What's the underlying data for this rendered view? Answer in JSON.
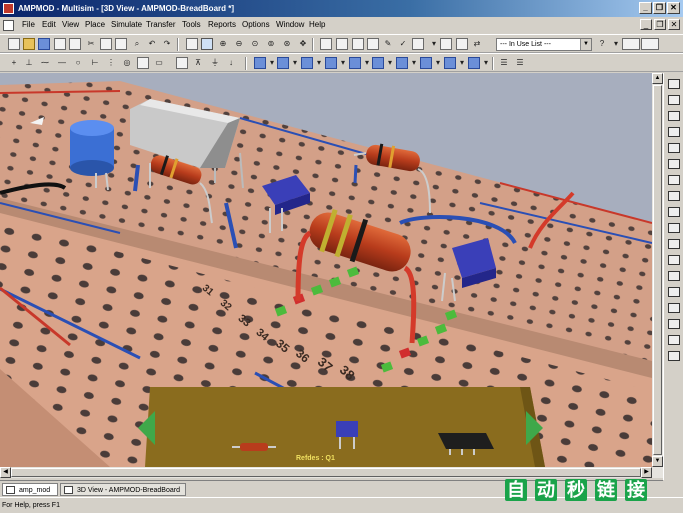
{
  "window": {
    "title": "AMPMOD - Multisim - [3D View - AMPMOD-BreadBoard *]",
    "minimize": "_",
    "restore": "❐",
    "close": "✕"
  },
  "menu": {
    "items": [
      "File",
      "Edit",
      "View",
      "Place",
      "Simulate",
      "Transfer",
      "Tools",
      "Reports",
      "Options",
      "Window",
      "Help"
    ],
    "mdi_minimize": "_",
    "mdi_restore": "❐",
    "mdi_close": "✕"
  },
  "toolbar": {
    "in_use_list": "--- In Use List ---"
  },
  "breadboard": {
    "row_numbers": [
      "31",
      "32",
      "33",
      "34",
      "35",
      "36",
      "37",
      "38"
    ],
    "refdes_label": "Refdes : Q1"
  },
  "tabs": [
    {
      "label": "amp_mod *"
    },
    {
      "label": "3D View - AMPMOD-BreadBoard *"
    }
  ],
  "status": {
    "text": "For Help, press F1"
  },
  "watermark": {
    "chars": [
      "自",
      "动",
      "秒",
      "链",
      "接"
    ]
  },
  "colors": {
    "viewport": "#a7aebe",
    "board": "#d9a48a",
    "panel": "#8a6c1e",
    "arrow_green": "#3fa84a"
  }
}
